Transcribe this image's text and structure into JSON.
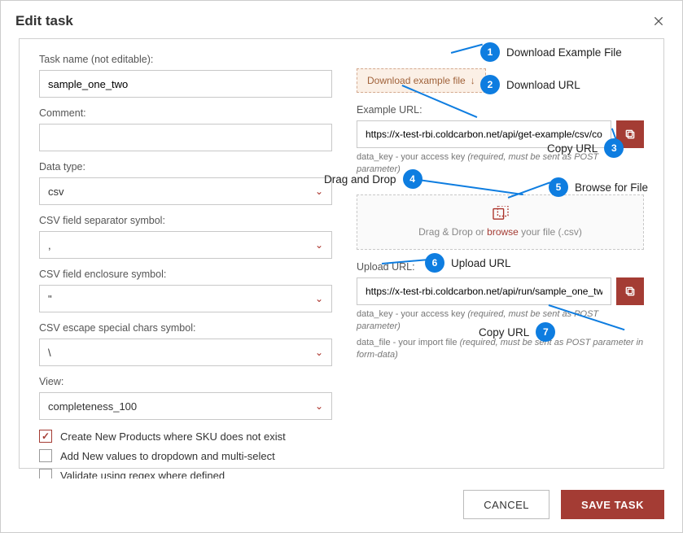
{
  "header": {
    "title": "Edit task"
  },
  "left": {
    "task_name_label": "Task name (not editable):",
    "task_name_value": "sample_one_two",
    "comment_label": "Comment:",
    "comment_value": "",
    "data_type_label": "Data type:",
    "data_type_value": "csv",
    "sep_label": "CSV field separator symbol:",
    "sep_value": ",",
    "enc_label": "CSV field enclosure symbol:",
    "enc_value": "\"",
    "esc_label": "CSV escape special chars symbol:",
    "esc_value": "\\",
    "view_label": "View:",
    "view_value": "completeness_100",
    "chk1": "Create New Products where SKU does not exist",
    "chk2": "Add New values to dropdown and multi-select",
    "chk3": "Validate using regex where defined"
  },
  "right": {
    "download_btn": "Download example file",
    "example_label": "Example URL:",
    "example_value": "https://x-test-rbi.coldcarbon.net/api/get-example/csv/co...",
    "example_hint_key": "data_key - your access key",
    "example_hint_req": "(required, must be sent as POST parameter)",
    "drop_prefix": "Drag & Drop or ",
    "drop_browse": "browse",
    "drop_suffix": " your file (.csv)",
    "upload_label": "Upload URL:",
    "upload_value": "https://x-test-rbi.coldcarbon.net/api/run/sample_one_two",
    "upload_hint1_key": "data_key - your access key",
    "upload_hint1_req": "(required, must be sent as POST parameter)",
    "upload_hint2_key": "data_file - your import file",
    "upload_hint2_req": "(required, must be sent as POST parameter in form-data)"
  },
  "footer": {
    "cancel": "CANCEL",
    "save": "SAVE TASK"
  },
  "ann": {
    "c1": "Download Example File",
    "c2": "Download URL",
    "c3": "Copy URL",
    "c4": "Drag and Drop",
    "c5": "Browse for File",
    "c6": "Upload URL",
    "c7": "Copy URL"
  }
}
